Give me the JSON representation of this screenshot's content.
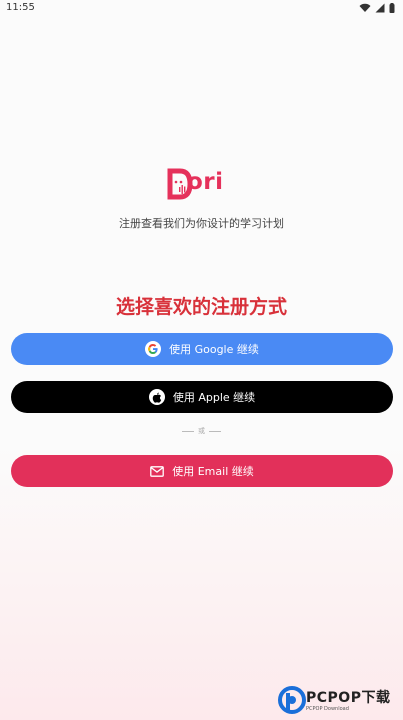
{
  "status_bar": {
    "time": "11:55"
  },
  "app": {
    "logo_text": "ori"
  },
  "subtitle": "注册查看我们为你设计的学习计划",
  "heading": "选择喜欢的注册方式",
  "buttons": {
    "google": "使用 Google 继续",
    "apple": "使用 Apple 继续",
    "email": "使用 Email 继续"
  },
  "divider": "或",
  "watermark": {
    "text": "PCPOP下载",
    "sub": "PCPOP Download"
  },
  "colors": {
    "google": "#4a8af4",
    "apple": "#000000",
    "email": "#e2305a",
    "accent": "#e5315b",
    "heading": "#d8313a"
  }
}
